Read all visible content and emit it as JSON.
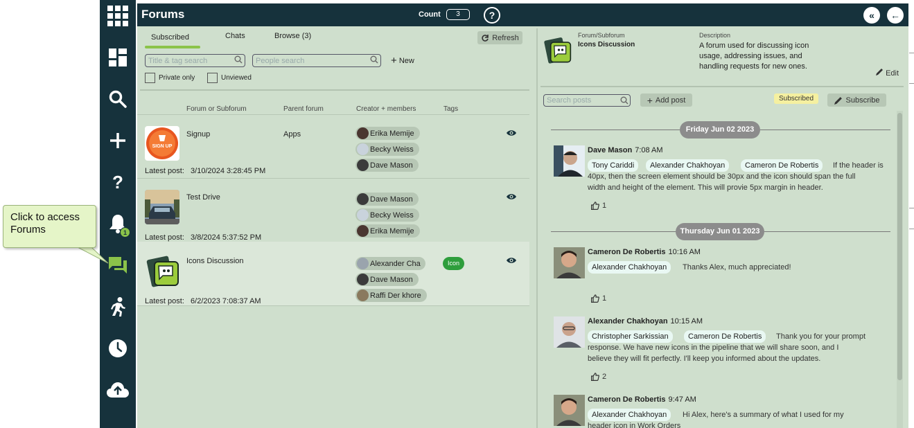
{
  "callout": {
    "text": "Click to access Forums"
  },
  "sidebar": {
    "notification_count": "1"
  },
  "header": {
    "title": "Forums",
    "count_label": "Count",
    "count_value": "3",
    "help": "?",
    "collapse": "«",
    "back": "←"
  },
  "tabs": {
    "subscribed": "Subscribed",
    "chats": "Chats",
    "browse": "Browse (3)"
  },
  "toolbar": {
    "refresh": "Refresh",
    "title_search_placeholder": "Title & tag search",
    "people_search_placeholder": "People search",
    "new": "New",
    "private_only": "Private only",
    "unviewed": "Unviewed"
  },
  "columns": {
    "forum": "Forum or Subforum",
    "parent": "Parent forum",
    "creator": "Creator + members",
    "tags": "Tags"
  },
  "forums": [
    {
      "name": "Signup",
      "parent": "Apps",
      "latest_label": "Latest post:",
      "latest": "3/10/2024 3:28:45 PM",
      "members": [
        "Erika Memije",
        "Becky Weiss",
        "Dave Mason"
      ],
      "logo_text": "SIGN UP"
    },
    {
      "name": "Test Drive",
      "parent": "",
      "latest_label": "Latest post:",
      "latest": "3/8/2024 5:37:52 PM",
      "members": [
        "Dave Mason",
        "Becky Weiss",
        "Erika Memije"
      ]
    },
    {
      "name": "Icons Discussion",
      "parent": "",
      "latest_label": "Latest post:",
      "latest": "6/2/2023 7:08:37 AM",
      "members": [
        "Alexander Cha",
        "Dave Mason",
        "Raffi Der khore"
      ],
      "tag": "Icon"
    }
  ],
  "detail": {
    "forum_label": "Forum/Subforum",
    "forum_name": "Icons Discussion",
    "description_label": "Description",
    "description": "A forum used for discussing icon usage, addressing issues, and handling requests for new ones.",
    "edit": "Edit",
    "search_posts_placeholder": "Search posts",
    "add_post": "Add post",
    "subscribed_badge": "Subscribed",
    "subscribe": "Subscribe"
  },
  "dates": [
    "Friday Jun 02 2023",
    "Thursday Jun 01 2023"
  ],
  "posts": [
    {
      "author": "Dave Mason",
      "time": "7:08 AM",
      "mentions": [
        "Tony Cariddi",
        "Alexander Chakhoyan",
        "Cameron De Robertis"
      ],
      "text1": "If the header is",
      "text2": "40px, then the screen element should be 30px and the icon should span the full",
      "text3": "width and height of the element. This will provie 5px margin in header.",
      "likes": "1"
    },
    {
      "author": "Cameron De Robertis",
      "time": "10:16 AM",
      "mentions": [
        "Alexander Chakhoyan"
      ],
      "text1": "Thanks Alex, much appreciated!",
      "likes": "1"
    },
    {
      "author": "Alexander Chakhoyan",
      "time": "10:15 AM",
      "mentions": [
        "Christopher Sarkissian",
        "Cameron De Robertis"
      ],
      "text1": "Thank you for your prompt",
      "text2": "response. We have new icons in the pipeline that we will share soon, and I",
      "text3": "believe they will fit perfectly. I'll keep you informed about the updates.",
      "likes": "2"
    },
    {
      "author": "Cameron De Robertis",
      "time": "9:47 AM",
      "mentions": [
        "Alexander Chakhoyan"
      ],
      "text1": "Hi Alex, here's a summary of what I used for my",
      "text2": "header icon in Work Orders"
    }
  ],
  "colors": {
    "sidebar": "#16323c",
    "panel": "#cfdfcd",
    "accent": "#8bc34a",
    "tag": "#2e9e3c"
  }
}
